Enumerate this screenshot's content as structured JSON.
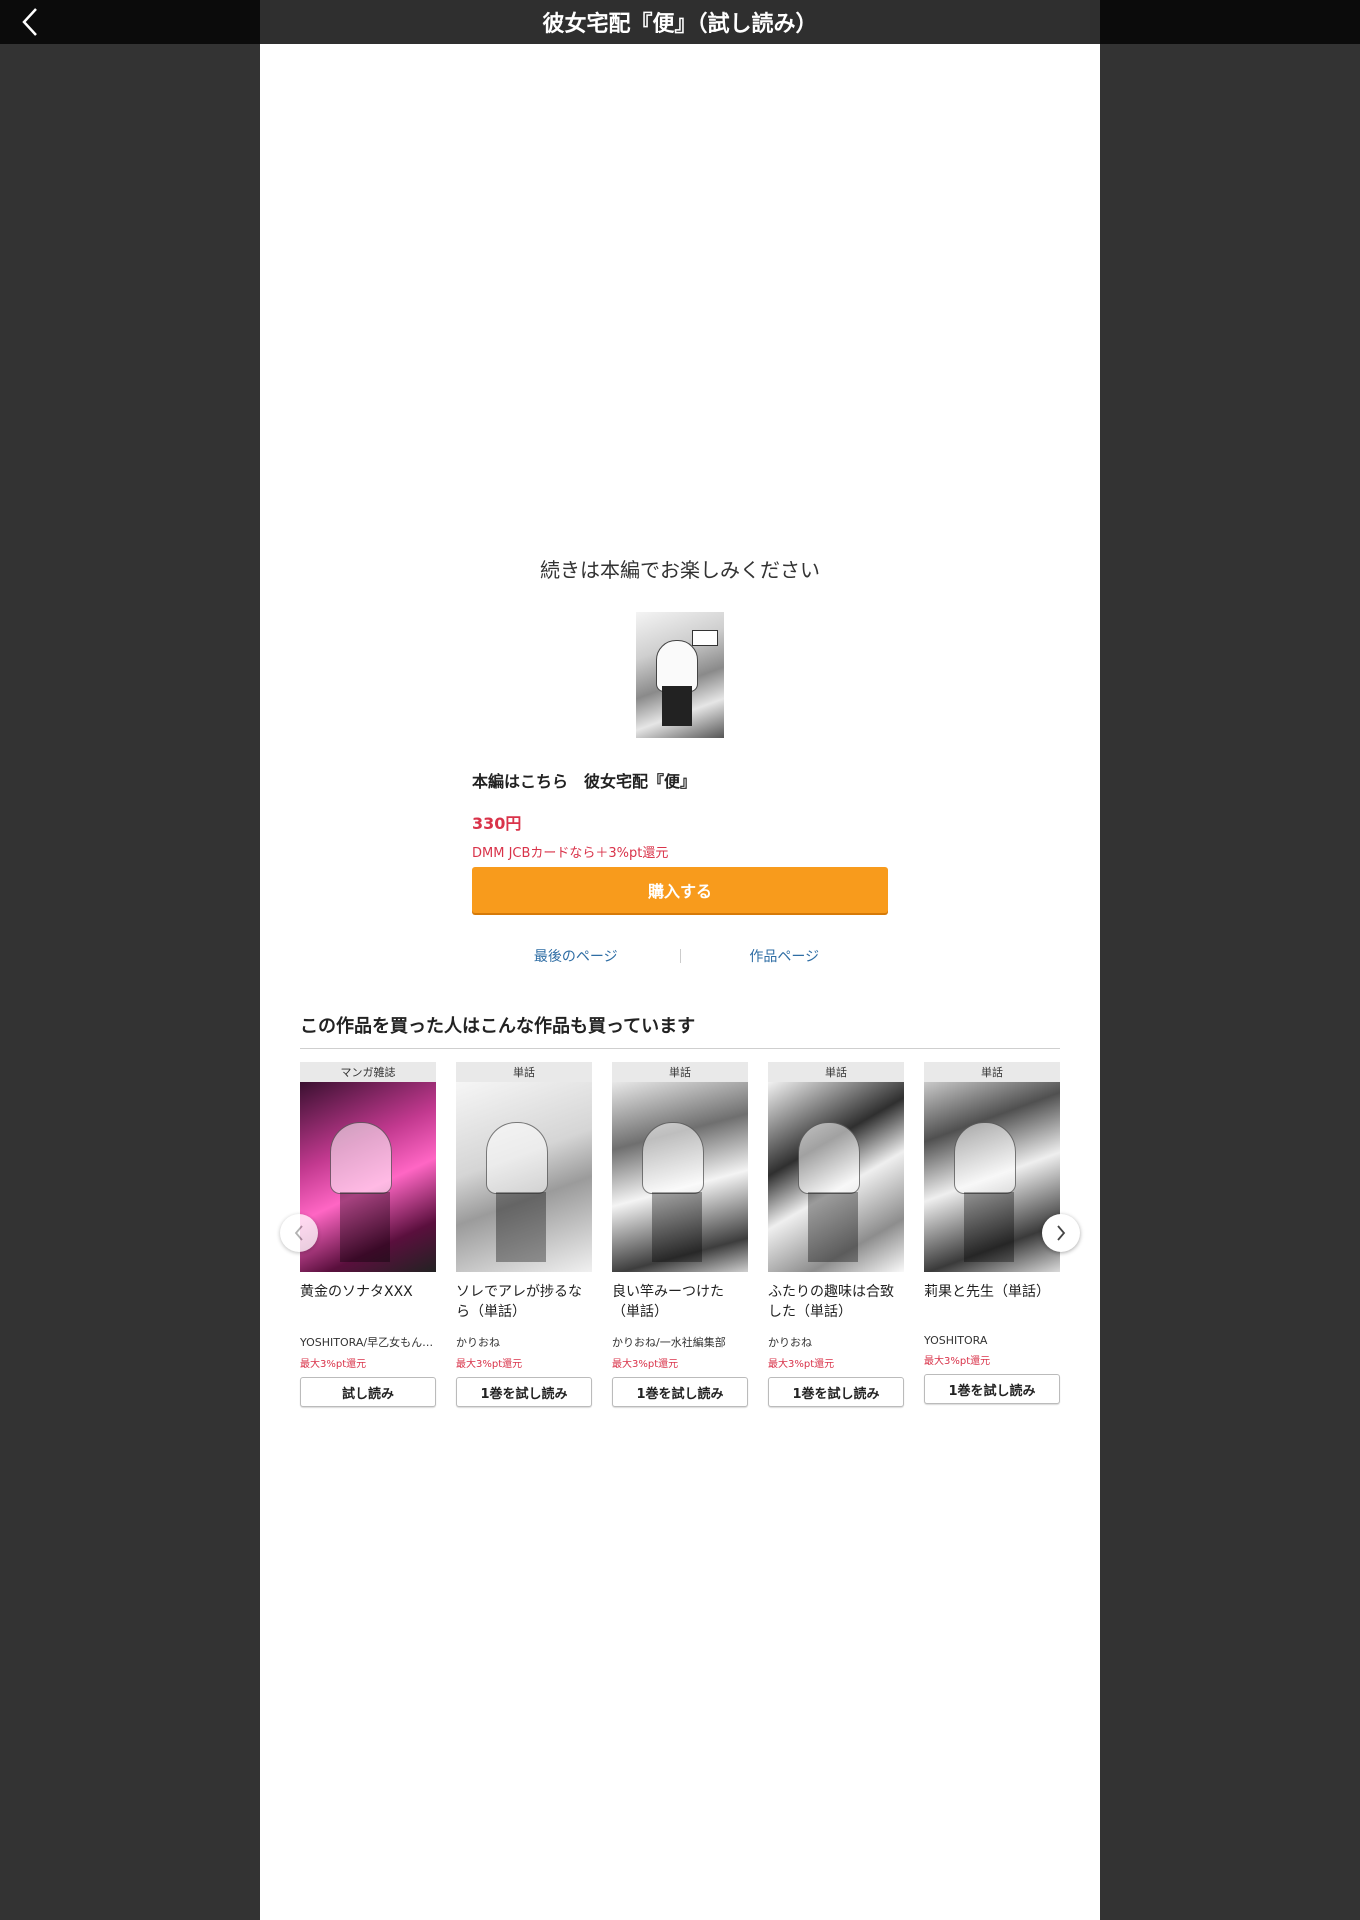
{
  "header": {
    "title": "彼女宅配『便』（試し読み）",
    "back_icon": "chevron-left-icon"
  },
  "end_panel": {
    "message": "続きは本編でお楽しみください",
    "buy_title": "本編はこちら　彼女宅配『便』",
    "price": "330円",
    "campaign": "DMM JCBカードなら＋3%pt還元",
    "buy_button": "購入する",
    "link_last_page": "最後のページ",
    "link_product_page": "作品ページ"
  },
  "recommend": {
    "section_title": "この作品を買った人はこんな作品も買っています",
    "prev_icon": "chevron-left-icon",
    "next_icon": "chevron-right-icon",
    "items": [
      {
        "badge": "マンガ雑誌",
        "title": "黄金のソナタXXX",
        "author": "YOSHITORA/早乙女もん…",
        "point": "最大3%pt還元",
        "button": "試し読み"
      },
      {
        "badge": "単話",
        "title": "ソレでアレが捗るなら（単話）",
        "author": "かりおね",
        "point": "最大3%pt還元",
        "button": "1巻を試し読み"
      },
      {
        "badge": "単話",
        "title": "良い竿みーつけた（単話）",
        "author": "かりおね/一水社編集部",
        "point": "最大3%pt還元",
        "button": "1巻を試し読み"
      },
      {
        "badge": "単話",
        "title": "ふたりの趣味は合致した（単話）",
        "author": "かりおね",
        "point": "最大3%pt還元",
        "button": "1巻を試し読み"
      },
      {
        "badge": "単話",
        "title": "莉果と先生（単話）",
        "author": "YOSHITORA",
        "point": "最大3%pt還元",
        "button": "1巻を試し読み"
      }
    ]
  },
  "colors": {
    "accent_orange": "#f89b1c",
    "price_red": "#d9334a",
    "link_blue": "#2e6da4"
  }
}
